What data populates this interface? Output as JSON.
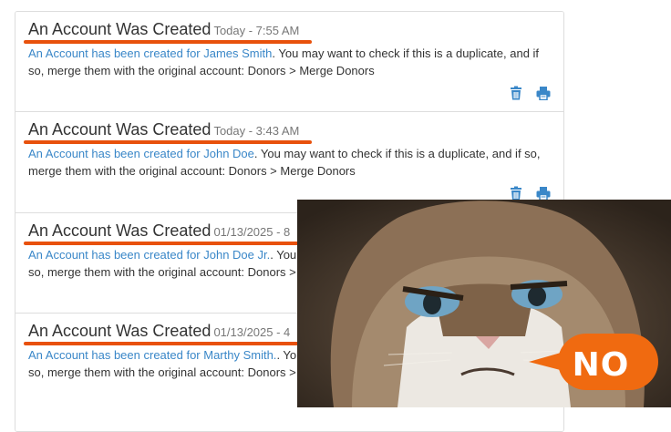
{
  "notifications": [
    {
      "title": "An Account Was Created",
      "time": "Today - 7:55 AM",
      "link_text": "An Account has been created for James Smith",
      "message": ". You may want to check if this is a duplicate, and if so, merge them with the original account: Donors > Merge Donors"
    },
    {
      "title": "An Account Was Created",
      "time": "Today - 3:43 AM",
      "link_text": "An Account has been created for John Doe",
      "message": ". You may want to check if this is a duplicate, and if so, merge them with the original account: Donors > Merge Donors"
    },
    {
      "title": "An Account Was Created",
      "time": "01/13/2025 - 8",
      "link_text": "An Account has been created for John Doe Jr.",
      "message": ". You may want to check if this is a duplicate, and if so, merge them with the original account: Donors > Merge Donors"
    },
    {
      "title": "An Account Was Created",
      "time": "01/13/2025 - 4",
      "link_text": "An Account has been created for Marthy Smith.",
      "message": ". You may want to check if this is a duplicate, and if so, merge them with the original account: Donors > Merge Donors"
    }
  ],
  "icons": {
    "delete": "trash-icon",
    "print": "print-icon"
  },
  "meme": {
    "bubble_text": "NO"
  },
  "colors": {
    "accent_underline": "#e8510c",
    "link": "#3a87c8",
    "icon": "#3a87c8",
    "bubble": "#f06a10"
  }
}
